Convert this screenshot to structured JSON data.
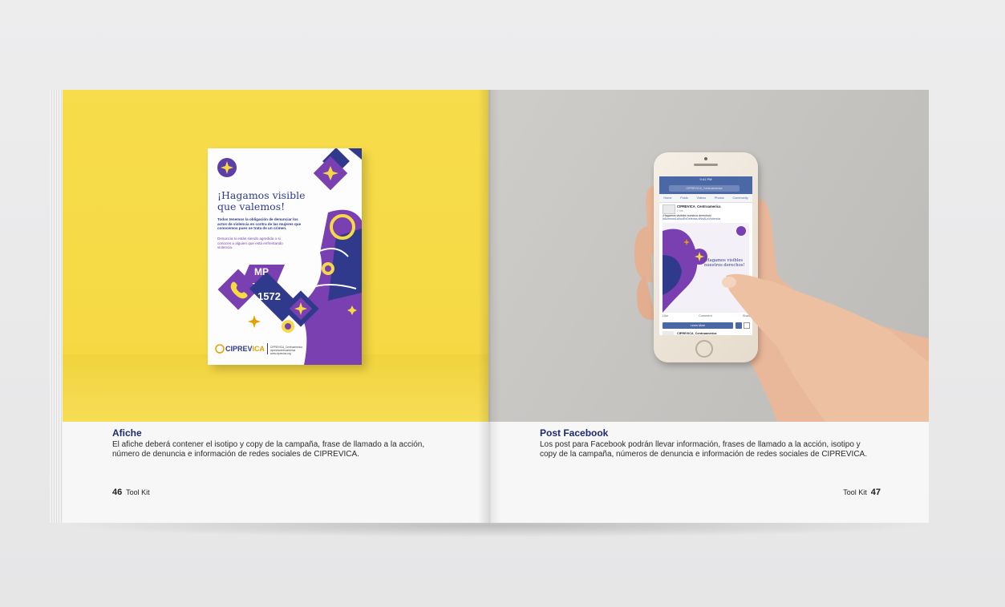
{
  "colors": {
    "yellow": "#f6d944",
    "navy": "#2f3a8c",
    "purple": "#7a3fb0",
    "gold": "#e6a100"
  },
  "left_page": {
    "caption_title": "Afiche",
    "caption_line1": "El afiche deberá contener el isotipo y copy de la campaña, frase de llamado a la acción,",
    "caption_line2": "número de denuncia e información de redes sociales de CIPREVICA.",
    "page_number": "46",
    "page_label": "Tool Kit",
    "poster": {
      "headline_line1": "¡Hagamos visible",
      "headline_line2": "que valemos!",
      "text1": "Todos tenemos la obligación de denunciar los actos de violencia en contra de las mujeres que conocemos pues se trata de un crimen.",
      "text2": "Denuncia si estás siendo agredida o si conoces a alguien que está enfrentando violencia.",
      "badge": "MP",
      "phone_number": "1572",
      "brand_main": "CIPREV",
      "brand_accent": "ICA",
      "social1": "CIPREVICA_Centroamerica",
      "social2": "cipreviacentroamerica",
      "social3": "www.ciprevica.org"
    }
  },
  "right_page": {
    "caption_title": "Post Facebook",
    "caption_line1": "Los post para Facebook podrán llevar información, frases de llamado a la acción, isotipo y",
    "caption_line2": "copy de la campaña, números de denuncia e información de redes sociales de CIPREVICA.",
    "page_number": "47",
    "page_label": "Tool Kit",
    "phone_screen": {
      "time": "9:41 PM",
      "search": "CIPREVICA_Centroamerica",
      "tabs": [
        "Home",
        "Posts",
        "Videos",
        "Photos",
        "Community"
      ],
      "page_name": "CIPREVICA_Centroamerica",
      "post_time": "2 hrs",
      "post_text": "¡Hagamos visibles nuestros derechos!",
      "post_hashtags": "#AlzemosLaVozEnDefensa #NoALaViolencia",
      "image_title_line1": "¡Hagamos visibles",
      "image_title_line2": "nuestros derechos!",
      "actions": [
        "Like",
        "Comment",
        "Share"
      ],
      "button": "Learn More",
      "next_page": "CIPREVICA_Centroamerica"
    }
  }
}
